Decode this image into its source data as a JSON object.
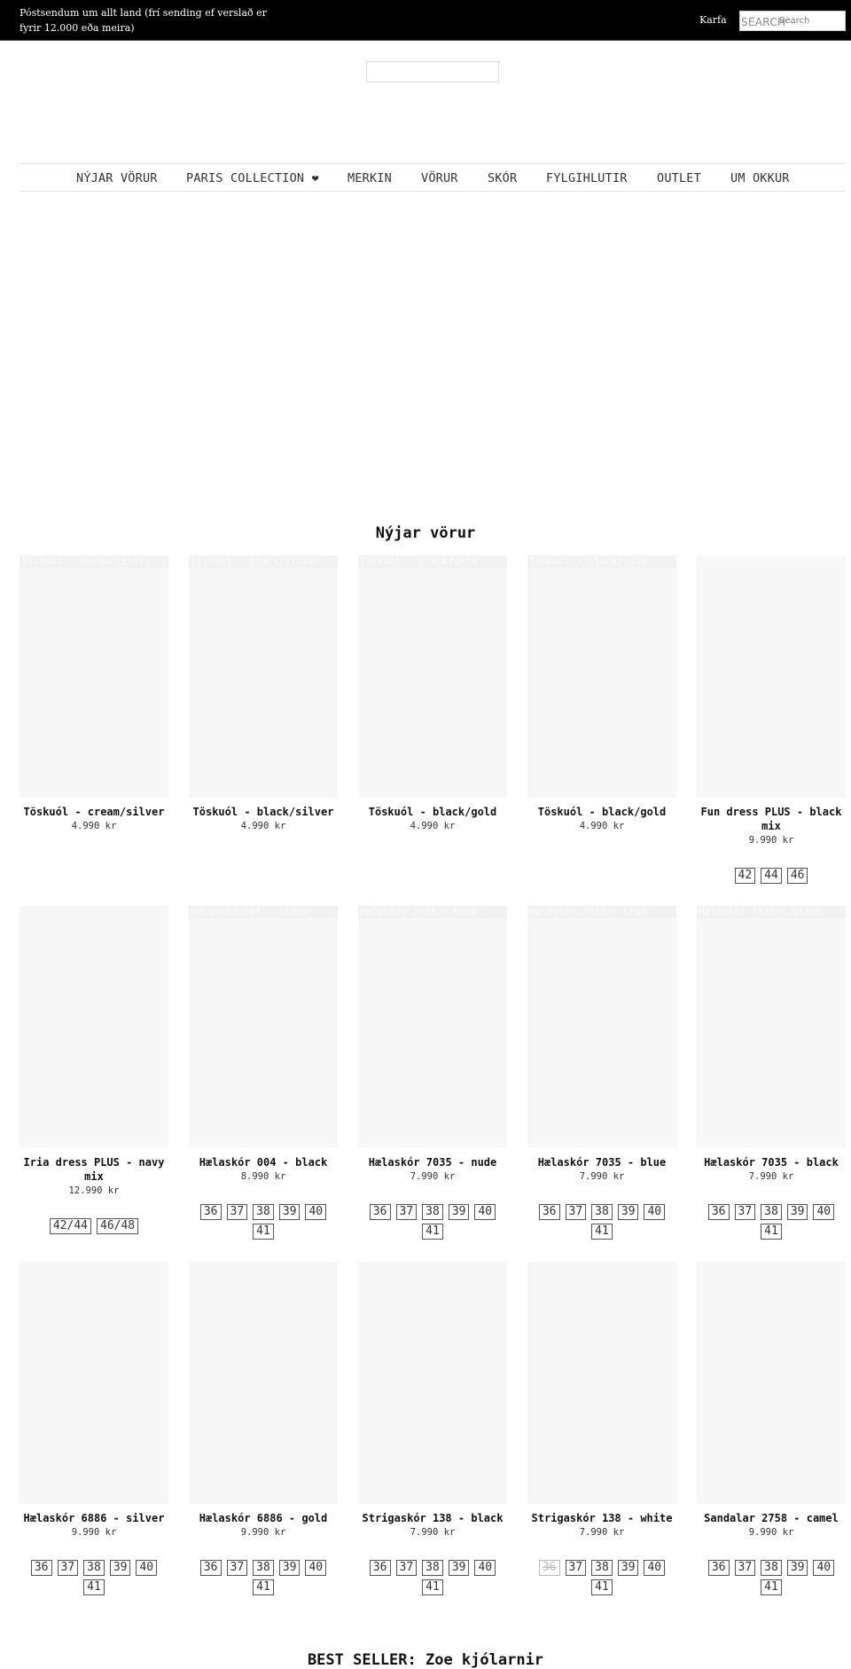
{
  "topbar": {
    "announcement": "Póstsendum um allt land (frí sending ef verslað er fyrir 12.000 eða meira)",
    "cart_label": "Karfa",
    "search_label": "SEARCH",
    "search_placeholder": "Search",
    "search_value": ""
  },
  "nav": {
    "items": [
      {
        "label": "NÝJAR VÖRUR"
      },
      {
        "label": "PARIS COLLECTION ❤"
      },
      {
        "label": "MERKIN"
      },
      {
        "label": "VÖRUR"
      },
      {
        "label": "SKÓR"
      },
      {
        "label": "FYLGIHLUTIR"
      },
      {
        "label": "OUTLET"
      },
      {
        "label": "UM OKKUR"
      }
    ]
  },
  "new_products": {
    "title": "Nýjar vörur",
    "products": [
      {
        "title": "Töskuól - cream/silver",
        "price": "4.990 kr",
        "img_alt": "Töskuól - cream/silver",
        "sizes": []
      },
      {
        "title": "Töskuól - black/silver",
        "price": "4.990 kr",
        "img_alt": "Töskuól - black/silver",
        "sizes": []
      },
      {
        "title": "Töskuól - black/gold",
        "price": "4.990 kr",
        "img_alt": "Töskuól - black/gold",
        "sizes": []
      },
      {
        "title": "Töskuól - black/gold",
        "price": "4.990 kr",
        "img_alt": "Töskuól - black/gold",
        "sizes": []
      },
      {
        "title": "Fun dress PLUS - black mix",
        "price": "9.990 kr",
        "img_alt": "",
        "sizes": [
          {
            "label": "42",
            "available": true
          },
          {
            "label": "44",
            "available": true
          },
          {
            "label": "46",
            "available": true
          }
        ]
      },
      {
        "title": "Iria dress PLUS - navy mix",
        "price": "12.990 kr",
        "img_alt": "",
        "sizes": [
          {
            "label": "42/44",
            "available": true
          },
          {
            "label": "46/48",
            "available": true
          }
        ]
      },
      {
        "title": "Hælaskór 004 - black",
        "price": "8.990 kr",
        "img_alt": "Hælaskór 004 - black",
        "sizes": [
          {
            "label": "36",
            "available": true
          },
          {
            "label": "37",
            "available": true
          },
          {
            "label": "38",
            "available": true
          },
          {
            "label": "39",
            "available": true
          },
          {
            "label": "40",
            "available": true
          },
          {
            "label": "41",
            "available": true
          }
        ]
      },
      {
        "title": "Hælaskór 7035 - nude",
        "price": "7.990 kr",
        "img_alt": "Hælaskór 7035 - nude",
        "sizes": [
          {
            "label": "36",
            "available": true
          },
          {
            "label": "37",
            "available": true
          },
          {
            "label": "38",
            "available": true
          },
          {
            "label": "39",
            "available": true
          },
          {
            "label": "40",
            "available": true
          },
          {
            "label": "41",
            "available": true
          }
        ]
      },
      {
        "title": "Hælaskór 7035 - blue",
        "price": "7.990 kr",
        "img_alt": "Hælaskór 7035 - blue",
        "sizes": [
          {
            "label": "36",
            "available": true
          },
          {
            "label": "37",
            "available": true
          },
          {
            "label": "38",
            "available": true
          },
          {
            "label": "39",
            "available": true
          },
          {
            "label": "40",
            "available": true
          },
          {
            "label": "41",
            "available": true
          }
        ]
      },
      {
        "title": "Hælaskór 7035 - black",
        "price": "7.990 kr",
        "img_alt": "Hælaskór 7035 - black",
        "sizes": [
          {
            "label": "36",
            "available": true
          },
          {
            "label": "37",
            "available": true
          },
          {
            "label": "38",
            "available": true
          },
          {
            "label": "39",
            "available": true
          },
          {
            "label": "40",
            "available": true
          },
          {
            "label": "41",
            "available": true
          }
        ]
      },
      {
        "title": "Hælaskór 6886 - silver",
        "price": "9.990 kr",
        "img_alt": "",
        "sizes": [
          {
            "label": "36",
            "available": true
          },
          {
            "label": "37",
            "available": true
          },
          {
            "label": "38",
            "available": true
          },
          {
            "label": "39",
            "available": true
          },
          {
            "label": "40",
            "available": true
          },
          {
            "label": "41",
            "available": true
          }
        ]
      },
      {
        "title": "Hælaskór 6886 - gold",
        "price": "9.990 kr",
        "img_alt": "",
        "sizes": [
          {
            "label": "36",
            "available": true
          },
          {
            "label": "37",
            "available": true
          },
          {
            "label": "38",
            "available": true
          },
          {
            "label": "39",
            "available": true
          },
          {
            "label": "40",
            "available": true
          },
          {
            "label": "41",
            "available": true
          }
        ]
      },
      {
        "title": "Strigaskór 138 - black",
        "price": "7.990 kr",
        "img_alt": "",
        "sizes": [
          {
            "label": "36",
            "available": true
          },
          {
            "label": "37",
            "available": true
          },
          {
            "label": "38",
            "available": true
          },
          {
            "label": "39",
            "available": true
          },
          {
            "label": "40",
            "available": true
          },
          {
            "label": "41",
            "available": true
          }
        ]
      },
      {
        "title": "Strigaskór 138 - white",
        "price": "7.990 kr",
        "img_alt": "",
        "sizes": [
          {
            "label": "36",
            "available": false
          },
          {
            "label": "37",
            "available": true
          },
          {
            "label": "38",
            "available": true
          },
          {
            "label": "39",
            "available": true
          },
          {
            "label": "40",
            "available": true
          },
          {
            "label": "41",
            "available": true
          }
        ]
      },
      {
        "title": "Sandalar 2758 - camel",
        "price": "9.990 kr",
        "img_alt": "",
        "sizes": [
          {
            "label": "36",
            "available": true
          },
          {
            "label": "37",
            "available": true
          },
          {
            "label": "38",
            "available": true
          },
          {
            "label": "39",
            "available": true
          },
          {
            "label": "40",
            "available": true
          },
          {
            "label": "41",
            "available": true
          }
        ]
      }
    ]
  },
  "bestseller": {
    "title": "BEST SELLER: Zoe kjólarnir"
  }
}
